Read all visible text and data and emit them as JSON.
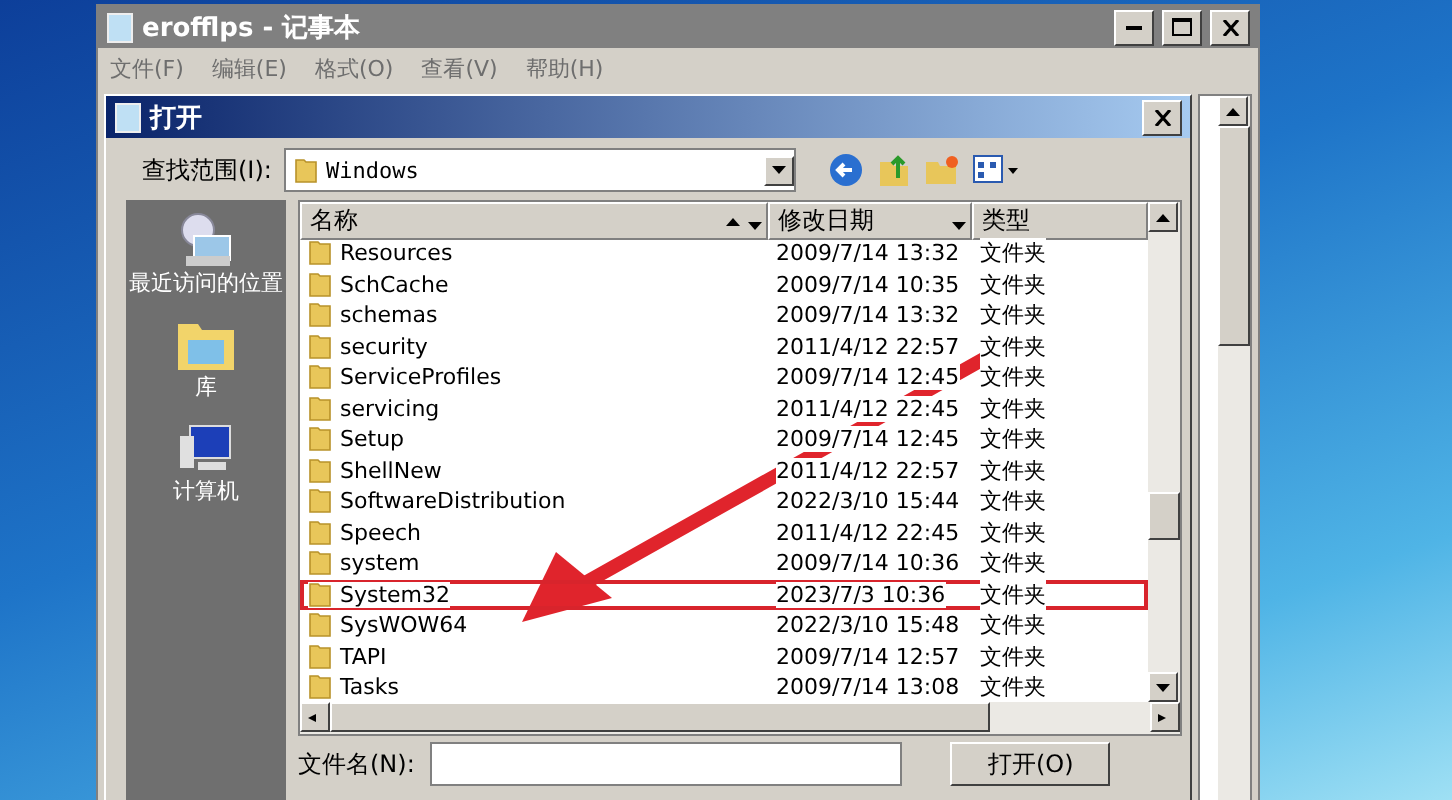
{
  "notepad": {
    "title": "erofflps - 记事本",
    "menu": [
      "文件(F)",
      "编辑(E)",
      "格式(O)",
      "查看(V)",
      "帮助(H)"
    ]
  },
  "dialog": {
    "title": "打开",
    "look_in_label": "查找范围(I):",
    "look_in_value": "Windows",
    "places": [
      {
        "label": "最近访问的位置",
        "kind": "recent"
      },
      {
        "label": "库",
        "kind": "library"
      },
      {
        "label": "计算机",
        "kind": "computer"
      }
    ],
    "columns": [
      "名称",
      "修改日期",
      "类型"
    ],
    "rows": [
      {
        "name": "Resources",
        "date": "2009/7/14 13:32",
        "type": "文件夹",
        "highlighted": false
      },
      {
        "name": "SchCache",
        "date": "2009/7/14 10:35",
        "type": "文件夹",
        "highlighted": false
      },
      {
        "name": "schemas",
        "date": "2009/7/14 13:32",
        "type": "文件夹",
        "highlighted": false
      },
      {
        "name": "security",
        "date": "2011/4/12 22:57",
        "type": "文件夹",
        "highlighted": false
      },
      {
        "name": "ServiceProfiles",
        "date": "2009/7/14 12:45",
        "type": "文件夹",
        "highlighted": false
      },
      {
        "name": "servicing",
        "date": "2011/4/12 22:45",
        "type": "文件夹",
        "highlighted": false
      },
      {
        "name": "Setup",
        "date": "2009/7/14 12:45",
        "type": "文件夹",
        "highlighted": false
      },
      {
        "name": "ShellNew",
        "date": "2011/4/12 22:57",
        "type": "文件夹",
        "highlighted": false
      },
      {
        "name": "SoftwareDistribution",
        "date": "2022/3/10 15:44",
        "type": "文件夹",
        "highlighted": false
      },
      {
        "name": "Speech",
        "date": "2011/4/12 22:45",
        "type": "文件夹",
        "highlighted": false
      },
      {
        "name": "system",
        "date": "2009/7/14 10:36",
        "type": "文件夹",
        "highlighted": false
      },
      {
        "name": "System32",
        "date": "2023/7/3 10:36",
        "type": "文件夹",
        "highlighted": true
      },
      {
        "name": "SysWOW64",
        "date": "2022/3/10 15:48",
        "type": "文件夹",
        "highlighted": false
      },
      {
        "name": "TAPI",
        "date": "2009/7/14 12:57",
        "type": "文件夹",
        "highlighted": false
      },
      {
        "name": "Tasks",
        "date": "2009/7/14 13:08",
        "type": "文件夹",
        "highlighted": false
      }
    ],
    "filename_label": "文件名(N):",
    "open_button": "打开(O)"
  }
}
